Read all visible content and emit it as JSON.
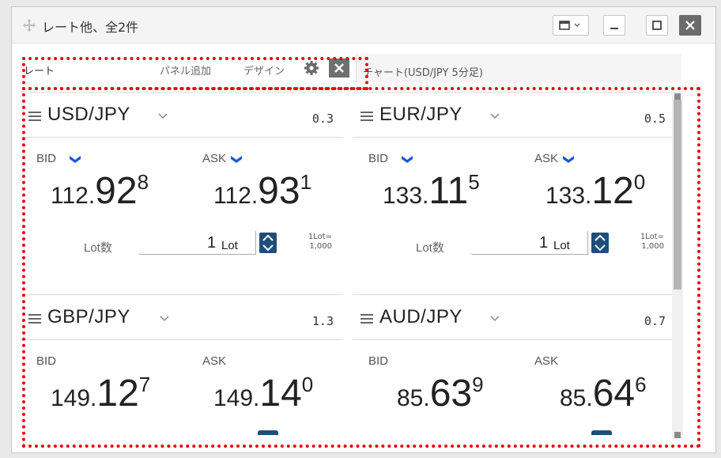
{
  "window": {
    "title": "レート他、全2件"
  },
  "tabs": {
    "rate": "レート",
    "add_panel": "パネル追加",
    "design": "デザイン",
    "chart": "チャート(USD/JPY 5分足)"
  },
  "panels": [
    {
      "pair": "USD/JPY",
      "spread": "0.3",
      "bid_label": "BID",
      "ask_label": "ASK",
      "bid": {
        "pre": "112.",
        "big": "92",
        "pip": "8"
      },
      "ask": {
        "pre": "112.",
        "big": "93",
        "pip": "1"
      },
      "lot_label": "Lot数",
      "lot_value": "1",
      "lot_unit": "Lot",
      "lot_size_1": "1Lot=",
      "lot_size_2": "1,000"
    },
    {
      "pair": "EUR/JPY",
      "spread": "0.5",
      "bid_label": "BID",
      "ask_label": "ASK",
      "bid": {
        "pre": "133.",
        "big": "11",
        "pip": "5"
      },
      "ask": {
        "pre": "133.",
        "big": "12",
        "pip": "0"
      },
      "lot_label": "Lot数",
      "lot_value": "1",
      "lot_unit": "Lot",
      "lot_size_1": "1Lot=",
      "lot_size_2": "1,000"
    },
    {
      "pair": "GBP/JPY",
      "spread": "1.3",
      "bid_label": "BID",
      "ask_label": "ASK",
      "bid": {
        "pre": "149.",
        "big": "12",
        "pip": "7"
      },
      "ask": {
        "pre": "149.",
        "big": "14",
        "pip": "0"
      }
    },
    {
      "pair": "AUD/JPY",
      "spread": "0.7",
      "bid_label": "BID",
      "ask_label": "ASK",
      "bid": {
        "pre": "85.",
        "big": "63",
        "pip": "9"
      },
      "ask": {
        "pre": "85.",
        "big": "64",
        "pip": "6"
      }
    }
  ],
  "colors": {
    "accent": "#1a56db",
    "stepper": "#1f4e79",
    "callout": "#e60012"
  }
}
